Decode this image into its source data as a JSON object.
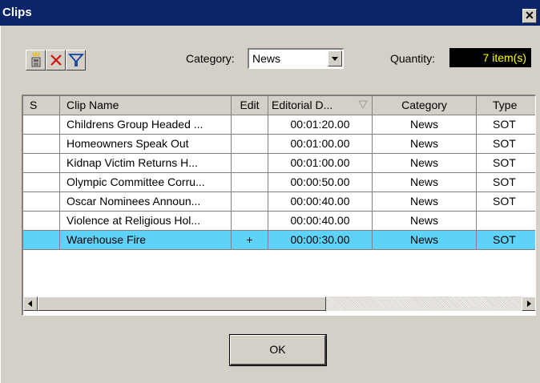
{
  "window": {
    "title": "Clips",
    "close_glyph": "✕"
  },
  "toolbar": {
    "icons": [
      "new-clip-icon",
      "delete-icon",
      "filter-icon"
    ]
  },
  "category": {
    "label": "Category:",
    "value": "News"
  },
  "quantity": {
    "label": "Quantity:",
    "value": "7 item(s)"
  },
  "table": {
    "columns": [
      "S",
      "Clip Name",
      "Edit",
      "Editorial D...",
      "Category",
      "Type"
    ],
    "rows": [
      {
        "s": "",
        "name": "Childrens Group Headed ...",
        "edit": "",
        "dur": "00:01:20.00",
        "category": "News",
        "type": "SOT"
      },
      {
        "s": "",
        "name": "Homeowners Speak Out",
        "edit": "",
        "dur": "00:01:00.00",
        "category": "News",
        "type": "SOT"
      },
      {
        "s": "",
        "name": "Kidnap Victim Returns H...",
        "edit": "",
        "dur": "00:01:00.00",
        "category": "News",
        "type": "SOT"
      },
      {
        "s": "",
        "name": "Olympic Committee Corru...",
        "edit": "",
        "dur": "00:00:50.00",
        "category": "News",
        "type": "SOT"
      },
      {
        "s": "",
        "name": "Oscar Nominees Announ...",
        "edit": "",
        "dur": "00:00:40.00",
        "category": "News",
        "type": "SOT"
      },
      {
        "s": "",
        "name": "Violence at Religious Hol...",
        "edit": "",
        "dur": "00:00:40.00",
        "category": "News",
        "type": ""
      },
      {
        "s": "",
        "name": "Warehouse Fire",
        "edit": "+",
        "dur": "00:00:30.00",
        "category": "News",
        "type": "SOT"
      }
    ],
    "selected_row": 6
  },
  "buttons": {
    "ok": "OK"
  },
  "colors": {
    "title_bar": "#0a246a",
    "selection": "#5ed2f7",
    "quantity_bg": "#000000",
    "quantity_fg": "#ffff00"
  }
}
